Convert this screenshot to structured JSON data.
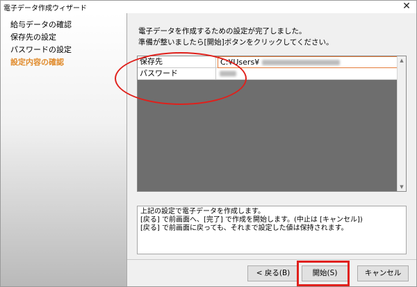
{
  "window": {
    "title": "電子データ作成ウィザード",
    "close_glyph": "✕"
  },
  "sidebar": {
    "steps": [
      {
        "label": "給与データの確認"
      },
      {
        "label": "保存先の設定"
      },
      {
        "label": "パスワードの設定"
      },
      {
        "label": "設定内容の確認",
        "current": true
      }
    ]
  },
  "message": {
    "line1": "電子データを作成するための設定が完了しました。",
    "line2": "準備が整いましたら[開始]ボタンをクリックしてください。"
  },
  "settings_grid": {
    "rows": [
      {
        "label": "保存先",
        "value": "C:¥Users¥"
      },
      {
        "label": "パスワード",
        "value": ""
      }
    ]
  },
  "note": {
    "line1": "上記の設定で電子データを作成します。",
    "line2": "[戻る] で前画面へ、[完了] で作成を開始します。(中止は [キャンセル])",
    "line3": "[戻る] で前画面に戻っても、それまで設定した値は保持されます。"
  },
  "buttons": {
    "back": "< 戻る(B)",
    "start": "開始(S)",
    "cancel": "キャンセル"
  },
  "colors": {
    "current_step": "#e08a2a",
    "annotation_red": "#e0201b",
    "grid_background": "#6e6e6e"
  }
}
